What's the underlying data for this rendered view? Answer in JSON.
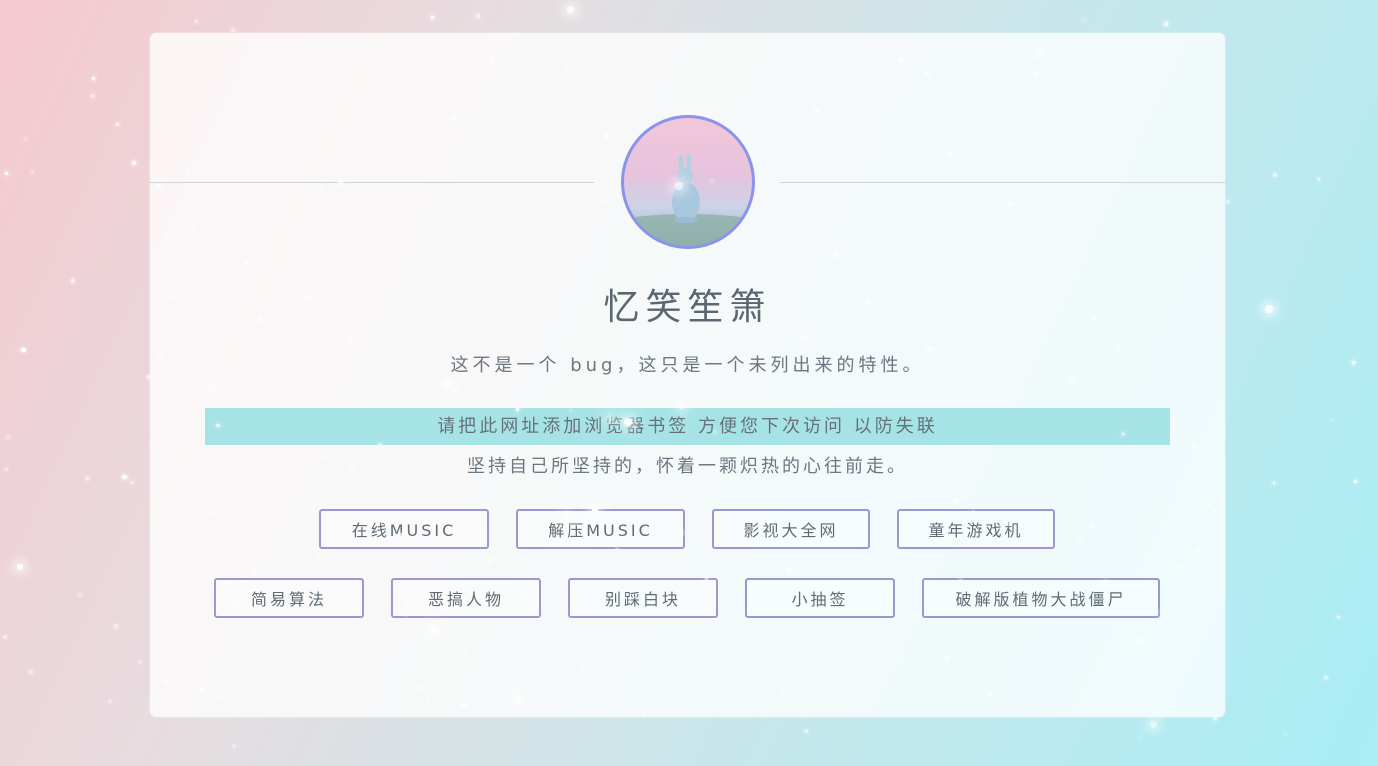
{
  "profile": {
    "name": "忆笑笙箫",
    "motto": "这不是一个 bug，这只是一个未列出来的特性。",
    "notice": "请把此网址添加浏览器书签 方便您下次访问 以防失联",
    "slogan": "坚持自己所坚持的，怀着一颗炽热的心往前走。"
  },
  "links": {
    "row1": [
      "在线MUSIC",
      "解压MUSIC",
      "影视大全网",
      "童年游戏机"
    ],
    "row2": [
      "简易算法",
      "恶搞人物",
      "别踩白块",
      "小抽签",
      "破解版植物大战僵尸"
    ]
  },
  "colors": {
    "accent_border": "#9d97cf",
    "avatar_ring": "#8b93ea",
    "notice_bg": "#a6e3e7",
    "text": "#5a6670"
  }
}
